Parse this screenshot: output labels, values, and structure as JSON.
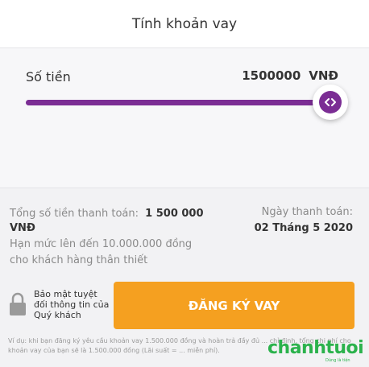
{
  "header": {
    "title": "Tính khoản vay"
  },
  "amount": {
    "label": "Số tiền",
    "value": "1500000",
    "currency": "VNĐ",
    "slider_fraction": 1.0
  },
  "summary": {
    "total_label": "Tổng số tiền thanh toán:",
    "total_value": "1 500 000",
    "total_currency": "VNĐ",
    "limit_text": "Hạn mức lên đến 10.000.000 đồng cho khách hàng thân thiết",
    "date_label": "Ngày thanh toán:",
    "date_value": "02 Tháng 5 2020"
  },
  "security": {
    "text": "Bảo mật tuyệt đối thông tin của Quý khách"
  },
  "actions": {
    "register_label": "ĐĂNG KÝ VAY"
  },
  "disclaimer": "Ví dụ: khi bạn đăng ký yêu cầu khoản vay 1.500.000 đồng và hoàn trả đầy đủ ... chỉ định, tổng chi phí cho khoản vay của bạn sẽ là 1.500.000 đồng (Lãi suất = ... miễn phí).",
  "watermark": {
    "brand": "chanhtuoi",
    "tagline": "Dùng là tiện"
  },
  "colors": {
    "accent_purple": "#7b2d94",
    "button_orange": "#f5a020",
    "watermark_green": "#2bb24c"
  },
  "icons": {
    "slider_thumb": "code-arrows-icon",
    "security": "lock-icon"
  }
}
